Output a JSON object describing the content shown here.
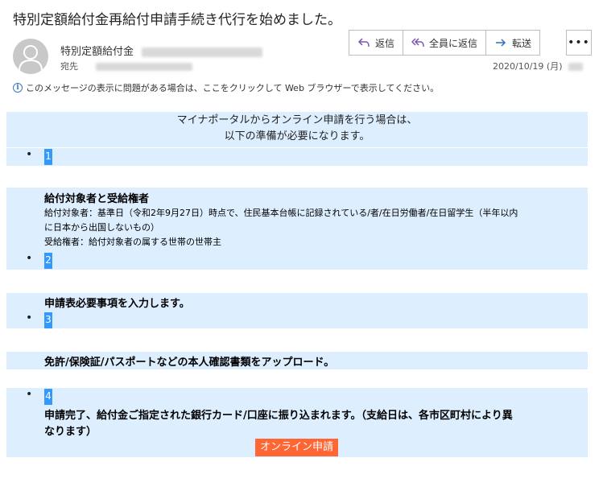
{
  "email": {
    "subject": "特別定額給付金再給付申請手続き代行を始めました。",
    "sender_name": "特別定額給付金",
    "to_label": "宛先",
    "date": "2020/10/19 (月)",
    "info_bar": "このメッセージの表示に問題がある場合は、ここをクリックして Web ブラウザーで表示してください。"
  },
  "actions": {
    "reply": "返信",
    "reply_all": "全員に返信",
    "forward": "転送",
    "more": "•••"
  },
  "body": {
    "heading_line1": "マイナポータルからオンライン申請を行う場合は、",
    "heading_line2": "以下の準備が必要になります。",
    "bullet": "•",
    "steps": [
      {
        "num": "1",
        "title": "給付対象者と受給権者",
        "lines": [
          "給付対象者：基準日（令和2年9月27日）時点で、住民基本台帳に記録されている/者/在日労働者/在日留学生（半年以内",
          "に日本から出国しないもの）",
          "受給権者：給付対象者の属する世帯の世帯主"
        ]
      },
      {
        "num": "2",
        "title": "申請表必要事項を入力します。"
      },
      {
        "num": "3",
        "title": "免許/保険証/パスポートなどの本人確認書類をアップロード。"
      },
      {
        "num": "4",
        "lines": [
          "申請完了、給付金ご指定された銀行カード/口座に振り込まれます。（支給日は、各市区町村により異",
          "なります）"
        ]
      }
    ],
    "cta": "オンライン申請"
  },
  "colors": {
    "band": "#ddeeff",
    "number_badge": "#3399ff",
    "cta": "#ff6633",
    "info_icon": "#3b78c4"
  },
  "icons": [
    "user-avatar-icon",
    "reply-icon",
    "reply-all-icon",
    "forward-icon",
    "more-icon",
    "info-icon"
  ]
}
